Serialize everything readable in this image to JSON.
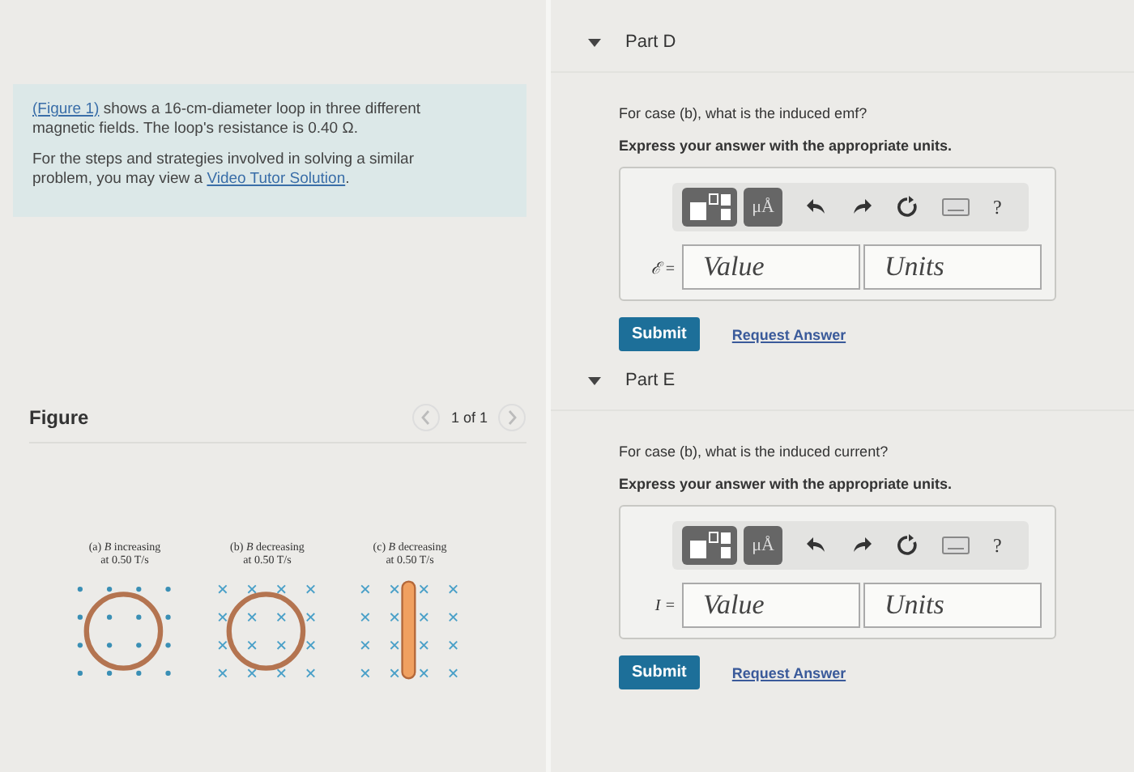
{
  "problem": {
    "intro": {
      "link": "(Figure 1)",
      "text": " shows a 16-cm-diameter loop in three different magnetic fields. The loop's resistance is 0.40 Ω."
    },
    "help": {
      "text": "For the steps and strategies involved in solving a similar problem, you may view a ",
      "link": "Video Tutor Solution",
      "after": "."
    }
  },
  "figure": {
    "title": "Figure",
    "pager": "1 of 1",
    "panels": [
      {
        "kind": "dots-loop",
        "label_1": "(a) *B* increasing",
        "label_2": "at 0.50 T/s"
      },
      {
        "kind": "crosses-loop",
        "label_1": "(b) *B* decreasing",
        "label_2": "at 0.50 T/s"
      },
      {
        "kind": "crosses-rod",
        "label_1": "(c) *B* decreasing",
        "label_2": "at 0.50 T/s"
      }
    ]
  },
  "parts": [
    {
      "title": "Part D",
      "expanded": true,
      "question": "For case (b), what is the induced emf?",
      "instruction": "Express your answer with the appropriate units.",
      "units_button": "μÅ",
      "help": "?",
      "variable": "ℰ =",
      "value_placeholder": "Value",
      "units_placeholder": "Units",
      "submit": "Submit",
      "request": "Request Answer"
    },
    {
      "title": "Part E",
      "expanded": true,
      "question": "For case (b), what is the induced current?",
      "instruction": "Express your answer with the appropriate units.",
      "units_button": "μÅ",
      "help": "?",
      "variable": "I =",
      "value_placeholder": "Value",
      "units_placeholder": "Units",
      "submit": "Submit",
      "request": "Request Answer"
    }
  ]
}
